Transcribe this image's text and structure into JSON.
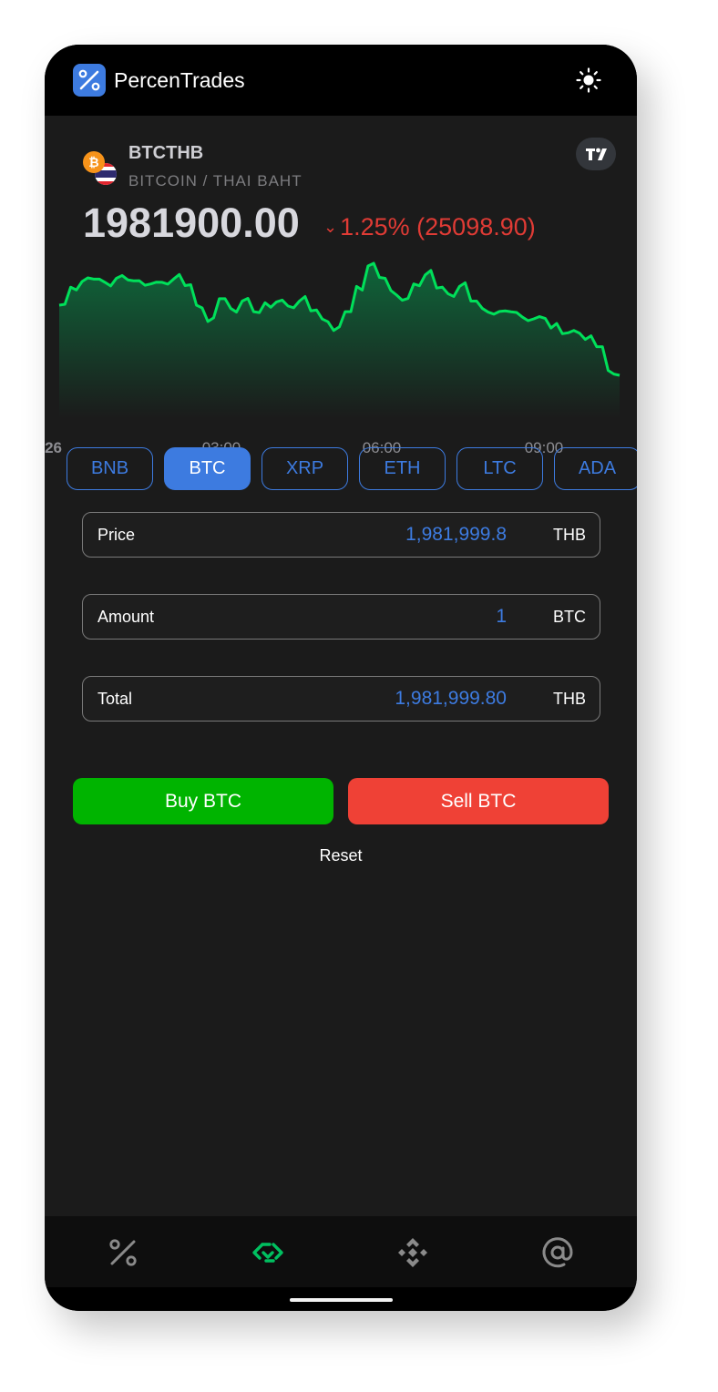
{
  "app": {
    "name": "PercenTrades",
    "logo_icon": "percent-icon",
    "theme_icon": "sun-icon"
  },
  "ticker": {
    "symbol": "BTCTHB",
    "pair_name": "BITCOIN / THAI BAHT",
    "last_price": "1981900.00",
    "change_arrow": "⌄",
    "change_text": "1.25% (25098.90)",
    "change_color": "#e03b35",
    "base_icon": "bitcoin-icon",
    "quote_icon": "thailand-flag-icon",
    "chart_link_icon": "tradingview-icon"
  },
  "chart_data": {
    "type": "area",
    "title": "",
    "line_color": "#00e05a",
    "x_ticks": [
      "26",
      "03:00",
      "06:00",
      "09:00"
    ],
    "grid": false,
    "series": [
      {
        "values": [
          1981000,
          1983200,
          1983900,
          1984200,
          1983800,
          1984300,
          1984100,
          1984000,
          1983600,
          1983800,
          1984200,
          1983400,
          1981000,
          1979000,
          1981800,
          1980600,
          1981500,
          1980200,
          1981300,
          1981400,
          1980900,
          1981500,
          1980300,
          1979300,
          1977900,
          1980200,
          1983300,
          1985800,
          1984400,
          1982800,
          1981600,
          1983600,
          1984700,
          1983100,
          1982400,
          1983300,
          1981500,
          1980600,
          1979900,
          1980300,
          1980100,
          1979100,
          1979600,
          1978200,
          1977500,
          1977900,
          1976800,
          1975900,
          1973000,
          1972400
        ]
      }
    ]
  },
  "symbols": {
    "items": [
      "BNB",
      "BTC",
      "XRP",
      "ETH",
      "LTC",
      "ADA"
    ],
    "active": "BTC"
  },
  "order_form": {
    "price": {
      "label": "Price",
      "value": "1,981,999.8",
      "unit": "THB"
    },
    "amount": {
      "label": "Amount",
      "value": "1",
      "unit": "BTC"
    },
    "total": {
      "label": "Total",
      "value": "1,981,999.80",
      "unit": "THB"
    },
    "buy_label": "Buy BTC",
    "sell_label": "Sell BTC",
    "reset_label": "Reset"
  },
  "colors": {
    "accent": "#3d7be0",
    "buy": "#00b400",
    "sell": "#ef4136",
    "nav_active": "#00c060"
  },
  "bottom_nav": [
    {
      "icon": "percent-icon",
      "active": false
    },
    {
      "icon": "trade-exchange-icon",
      "active": true
    },
    {
      "icon": "binance-icon",
      "active": false
    },
    {
      "icon": "at-sign-icon",
      "active": false
    }
  ]
}
